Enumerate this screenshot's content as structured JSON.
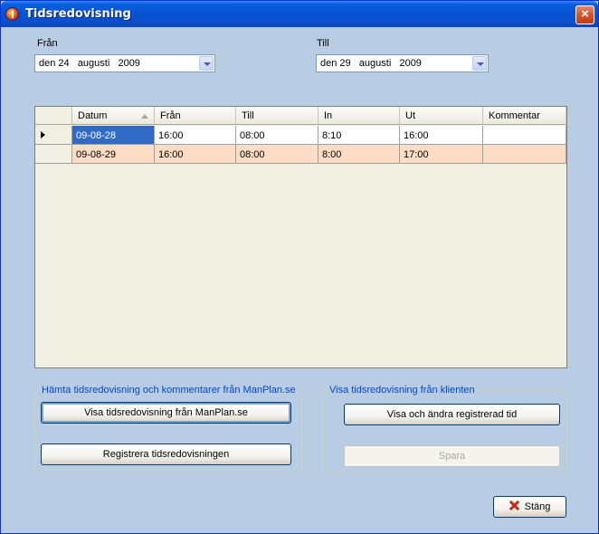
{
  "window": {
    "title": "Tidsredovisning",
    "close_label": "×"
  },
  "filters": {
    "from_label": "Från",
    "from_value": "den 24   augusti   2009",
    "to_label": "Till",
    "to_value": "den 29   augusti   2009"
  },
  "table": {
    "columns": [
      "Datum",
      "Från",
      "Till",
      "In",
      "Ut",
      "Kommentar"
    ],
    "rows": [
      [
        "09-08-28",
        "16:00",
        "08:00",
        "8:10",
        "16:00",
        ""
      ],
      [
        "09-08-29",
        "16:00",
        "08:00",
        "8:00",
        "17:00",
        ""
      ]
    ]
  },
  "manplan_group": {
    "legend": "Hämta tidsredovisning och kommentarer från ManPlan.se",
    "show_button": "Visa tidsredovisning från ManPlan.se",
    "register_button": "Registrera tidsredovisningen"
  },
  "client_group": {
    "legend": "Visa tidsredovisning från klienten",
    "show_button": "Visa och ändra registrerad tid",
    "save_button": "Spara"
  },
  "footer": {
    "close_button": "Stäng"
  },
  "colors": {
    "title_bar": "#0853d6",
    "selected_cell": "#316ac5",
    "alt_row": "#fcdcc4",
    "legend_text": "#0046d5"
  }
}
